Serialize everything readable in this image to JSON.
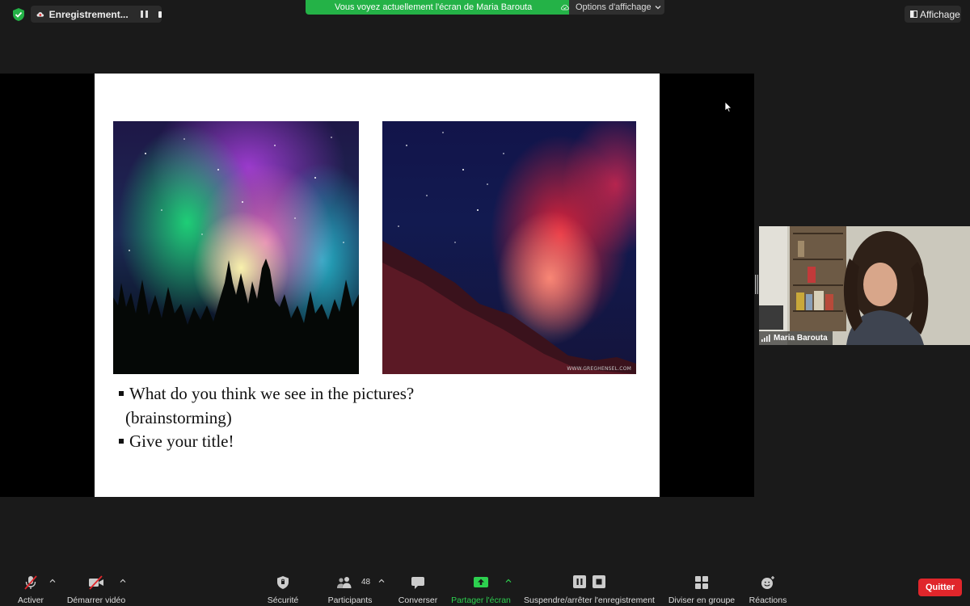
{
  "top_bar": {
    "recording_label": "Enregistrement...",
    "share_banner_text": "Vous voyez actuellement l'écran de Maria Barouta",
    "view_options_label": "Options d'affichage",
    "display_label": "Affichage",
    "icons": [
      "shield-check-icon",
      "cloud-recording-icon",
      "pause-icon",
      "stop-icon",
      "cloud-icon",
      "chevron-down-icon",
      "display-icon"
    ],
    "colors": {
      "share_banner": "#24b247",
      "shield": "#24b247",
      "recording_dot": "#e0262b"
    }
  },
  "slide": {
    "watermark": "WWW.GREGHENSEL.COM",
    "bullets": [
      "What do you think we see in the pictures?",
      "(brainstorming)",
      "Give your title!"
    ]
  },
  "participant": {
    "name": "Maria Barouta",
    "icons": [
      "signal-strength-icon"
    ]
  },
  "toolbar": {
    "mute_label": "Activer",
    "video_label": "Démarrer vidéo",
    "security_label": "Sécurité",
    "participants_label": "Participants",
    "participants_count": "48",
    "chat_label": "Converser",
    "share_label": "Partager l'écran",
    "record_label": "Suspendre/arrêter l'enregistrement",
    "breakout_label": "Diviser en groupe",
    "reactions_label": "Réactions",
    "quit_label": "Quitter",
    "icons": [
      "muted-mic-icon",
      "video-off-icon",
      "shield-icon",
      "participants-icon",
      "chat-bubble-icon",
      "share-screen-icon",
      "pause-recording-icon",
      "stop-recording-icon",
      "breakout-rooms-icon",
      "reaction-emoji-icon"
    ],
    "colors": {
      "share_active": "#2dd04f",
      "quit": "#e0262b",
      "muted": "#e0262b"
    }
  }
}
